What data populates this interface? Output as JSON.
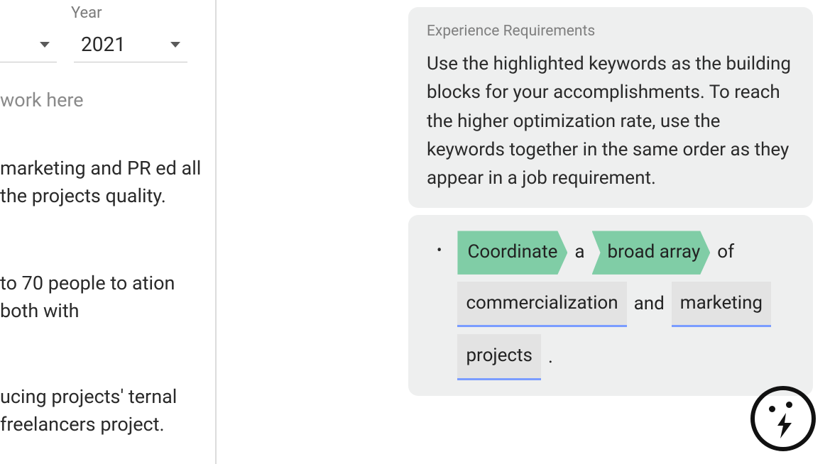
{
  "left": {
    "year_label": "Year",
    "year_value": "2021",
    "placeholder": "work here",
    "para1": "marketing and PR ed all the projects quality.",
    "para2": " to 70 people to ation both with",
    "para3": "ucing projects' ternal freelancers project."
  },
  "panel": {
    "title": "Experience Requirements",
    "body": "Use the highlighted keywords as the building blocks for your accomplishments. To reach the higher optimization rate, use the keywords together in the same order as they appear in a job requirement."
  },
  "requirement": {
    "kw1": "Coordinate",
    "w1": "a",
    "kw2": "broad array",
    "w2": "of",
    "kw3": "commercialization",
    "w3": "and",
    "kw4": "marketing",
    "kw5": "projects",
    "w4": "."
  }
}
